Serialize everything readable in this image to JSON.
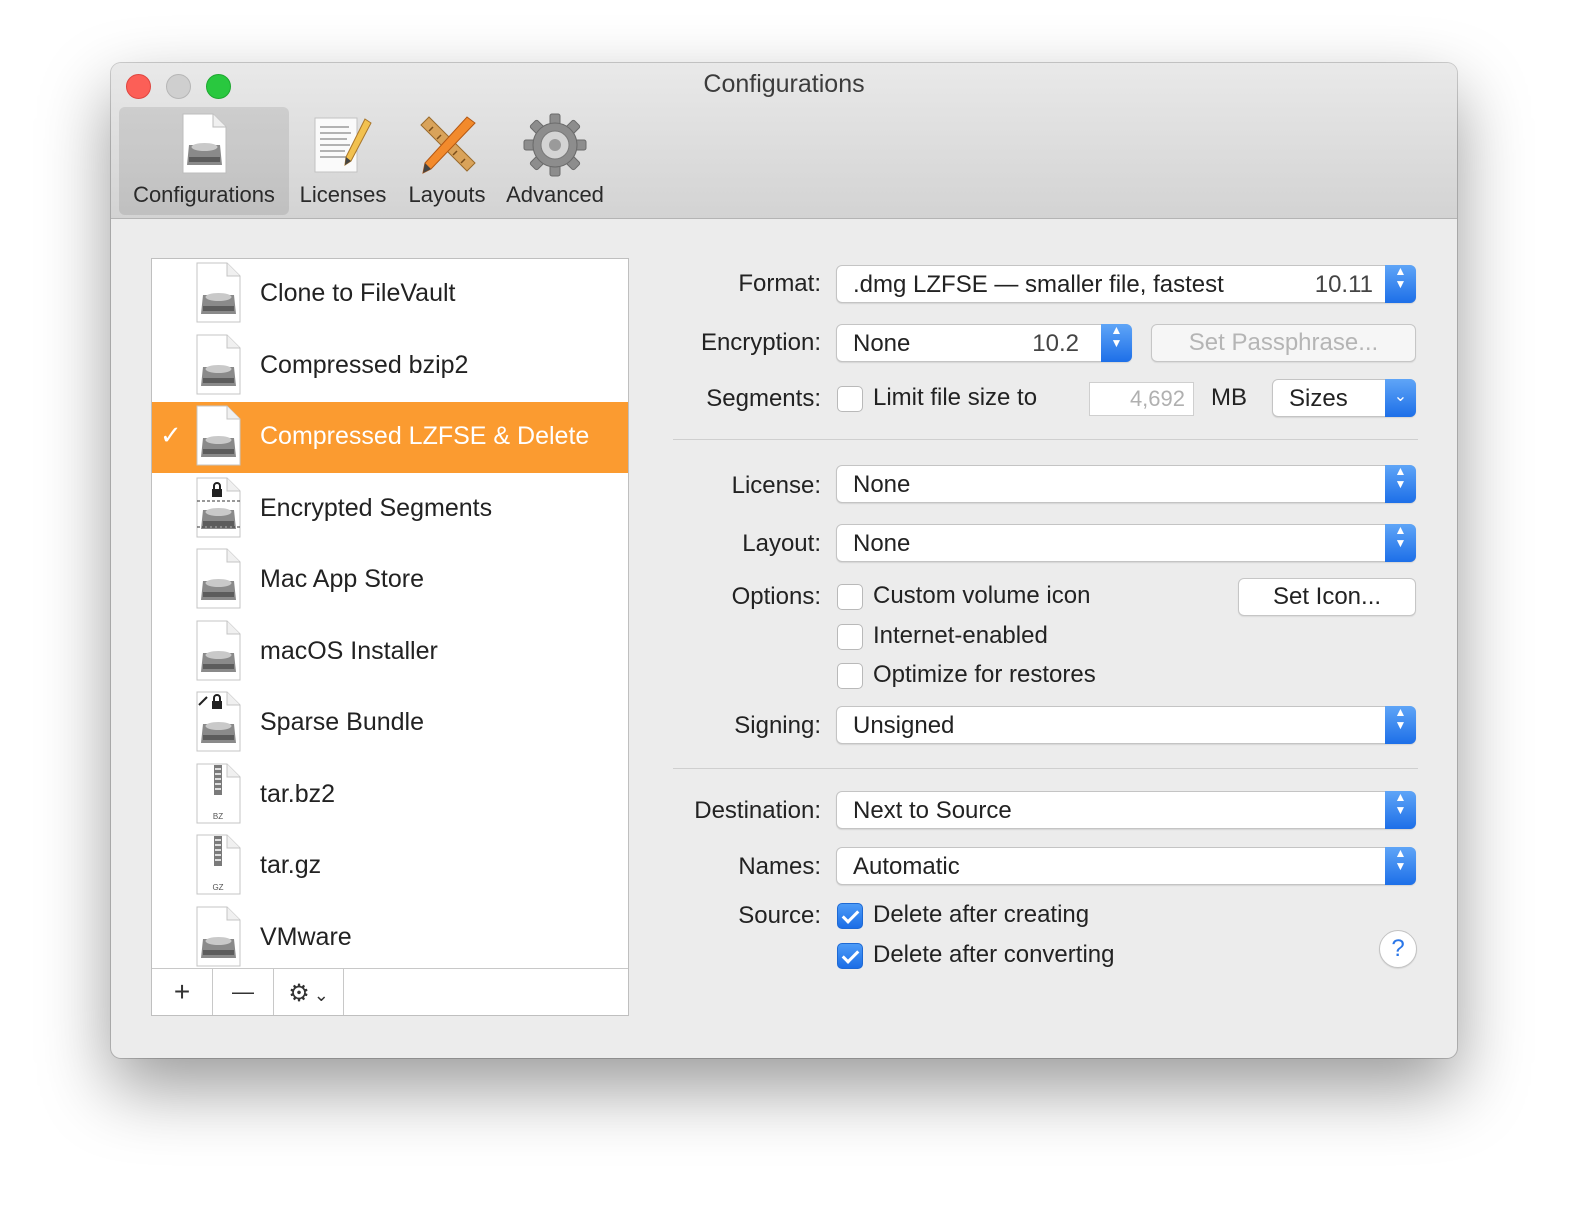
{
  "window": {
    "title": "Configurations"
  },
  "toolbar": {
    "items": [
      {
        "label": "Configurations",
        "icon": "disk-image-icon",
        "active": true
      },
      {
        "label": "Licenses",
        "icon": "document-pencil-icon"
      },
      {
        "label": "Layouts",
        "icon": "ruler-pencil-icon"
      },
      {
        "label": "Advanced",
        "icon": "gear-icon"
      }
    ]
  },
  "configurations": {
    "items": [
      {
        "label": "Clone to FileVault",
        "icon": "disk-image-icon"
      },
      {
        "label": "Compressed bzip2",
        "icon": "disk-image-icon"
      },
      {
        "label": "Compressed LZFSE & Delete",
        "icon": "disk-image-icon",
        "selected": true,
        "check": "✓"
      },
      {
        "label": "Encrypted Segments",
        "icon": "encrypted-segments-icon"
      },
      {
        "label": "Mac App Store",
        "icon": "disk-image-icon"
      },
      {
        "label": "macOS Installer",
        "icon": "disk-image-icon"
      },
      {
        "label": "Sparse Bundle",
        "icon": "sparse-bundle-icon"
      },
      {
        "label": "tar.bz2",
        "icon": "archive-bz-icon",
        "badge": "BZ"
      },
      {
        "label": "tar.gz",
        "icon": "archive-gz-icon",
        "badge": "GZ"
      },
      {
        "label": "VMware",
        "icon": "disk-image-icon"
      }
    ],
    "add_glyph": "+",
    "remove_glyph": "—",
    "action_glyph": "⚙",
    "action_chevron": "⌄"
  },
  "form": {
    "format": {
      "label": "Format:",
      "value": ".dmg LZFSE — smaller file, fastest",
      "version": "10.11"
    },
    "encryption": {
      "label": "Encryption:",
      "value": "None",
      "version": "10.2",
      "passphrase_button": "Set Passphrase..."
    },
    "segments": {
      "label": "Segments:",
      "checkbox_label": "Limit file size to",
      "checked": false,
      "size_value": "4,692",
      "unit": "MB",
      "sizes_button": "Sizes"
    },
    "license": {
      "label": "License:",
      "value": "None"
    },
    "layout": {
      "label": "Layout:",
      "value": "None"
    },
    "options": {
      "label": "Options:",
      "set_icon_button": "Set Icon...",
      "items": [
        {
          "label": "Custom volume icon",
          "checked": false
        },
        {
          "label": "Internet-enabled",
          "checked": false
        },
        {
          "label": "Optimize for restores",
          "checked": false
        }
      ]
    },
    "signing": {
      "label": "Signing:",
      "value": "Unsigned"
    },
    "destination": {
      "label": "Destination:",
      "value": "Next to Source"
    },
    "names": {
      "label": "Names:",
      "value": "Automatic"
    },
    "source": {
      "label": "Source:",
      "items": [
        {
          "label": "Delete after creating",
          "checked": true
        },
        {
          "label": "Delete after converting",
          "checked": true
        }
      ]
    },
    "help_glyph": "?"
  },
  "colors": {
    "selection": "#fb9b30",
    "accent": "#1d6fe8",
    "close": "#fc5f57",
    "zoom": "#29c83f"
  }
}
